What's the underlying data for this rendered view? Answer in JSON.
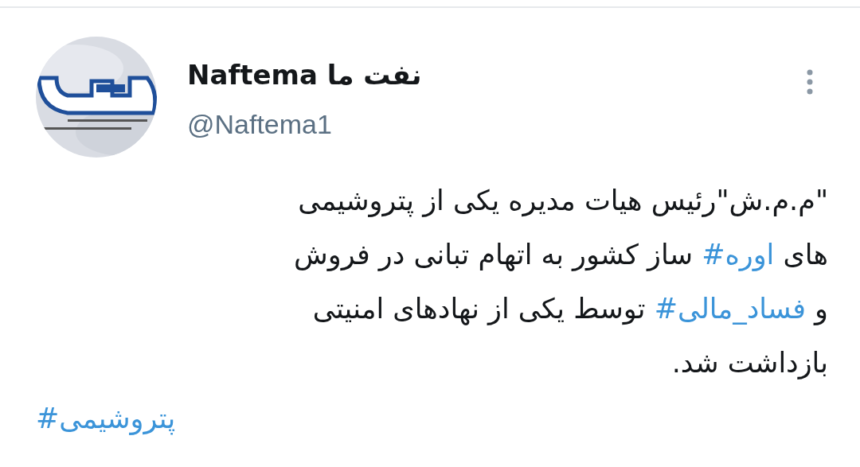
{
  "author": {
    "name": "Naftema نفت ما",
    "handle": "@Naftema1"
  },
  "body": {
    "lines": [
      [
        {
          "kind": "text",
          "text": "\"م.م.ش\"رئیس هیات مدیره یکی از پتروشیمی"
        }
      ],
      [
        {
          "kind": "text",
          "text": "های "
        },
        {
          "kind": "hashtag",
          "text": "#اوره"
        },
        {
          "kind": "text",
          "text": " ساز کشور به اتهام تبانی در فروش"
        }
      ],
      [
        {
          "kind": "text",
          "text": "و "
        },
        {
          "kind": "hashtag",
          "text": "#فساد_مالی"
        },
        {
          "kind": "text",
          "text": " توسط یکی از نهادهای امنیتی"
        }
      ],
      [
        {
          "kind": "text",
          "text": "بازداشت شد."
        }
      ]
    ]
  },
  "tags": [
    "#پتروشیمی"
  ]
}
